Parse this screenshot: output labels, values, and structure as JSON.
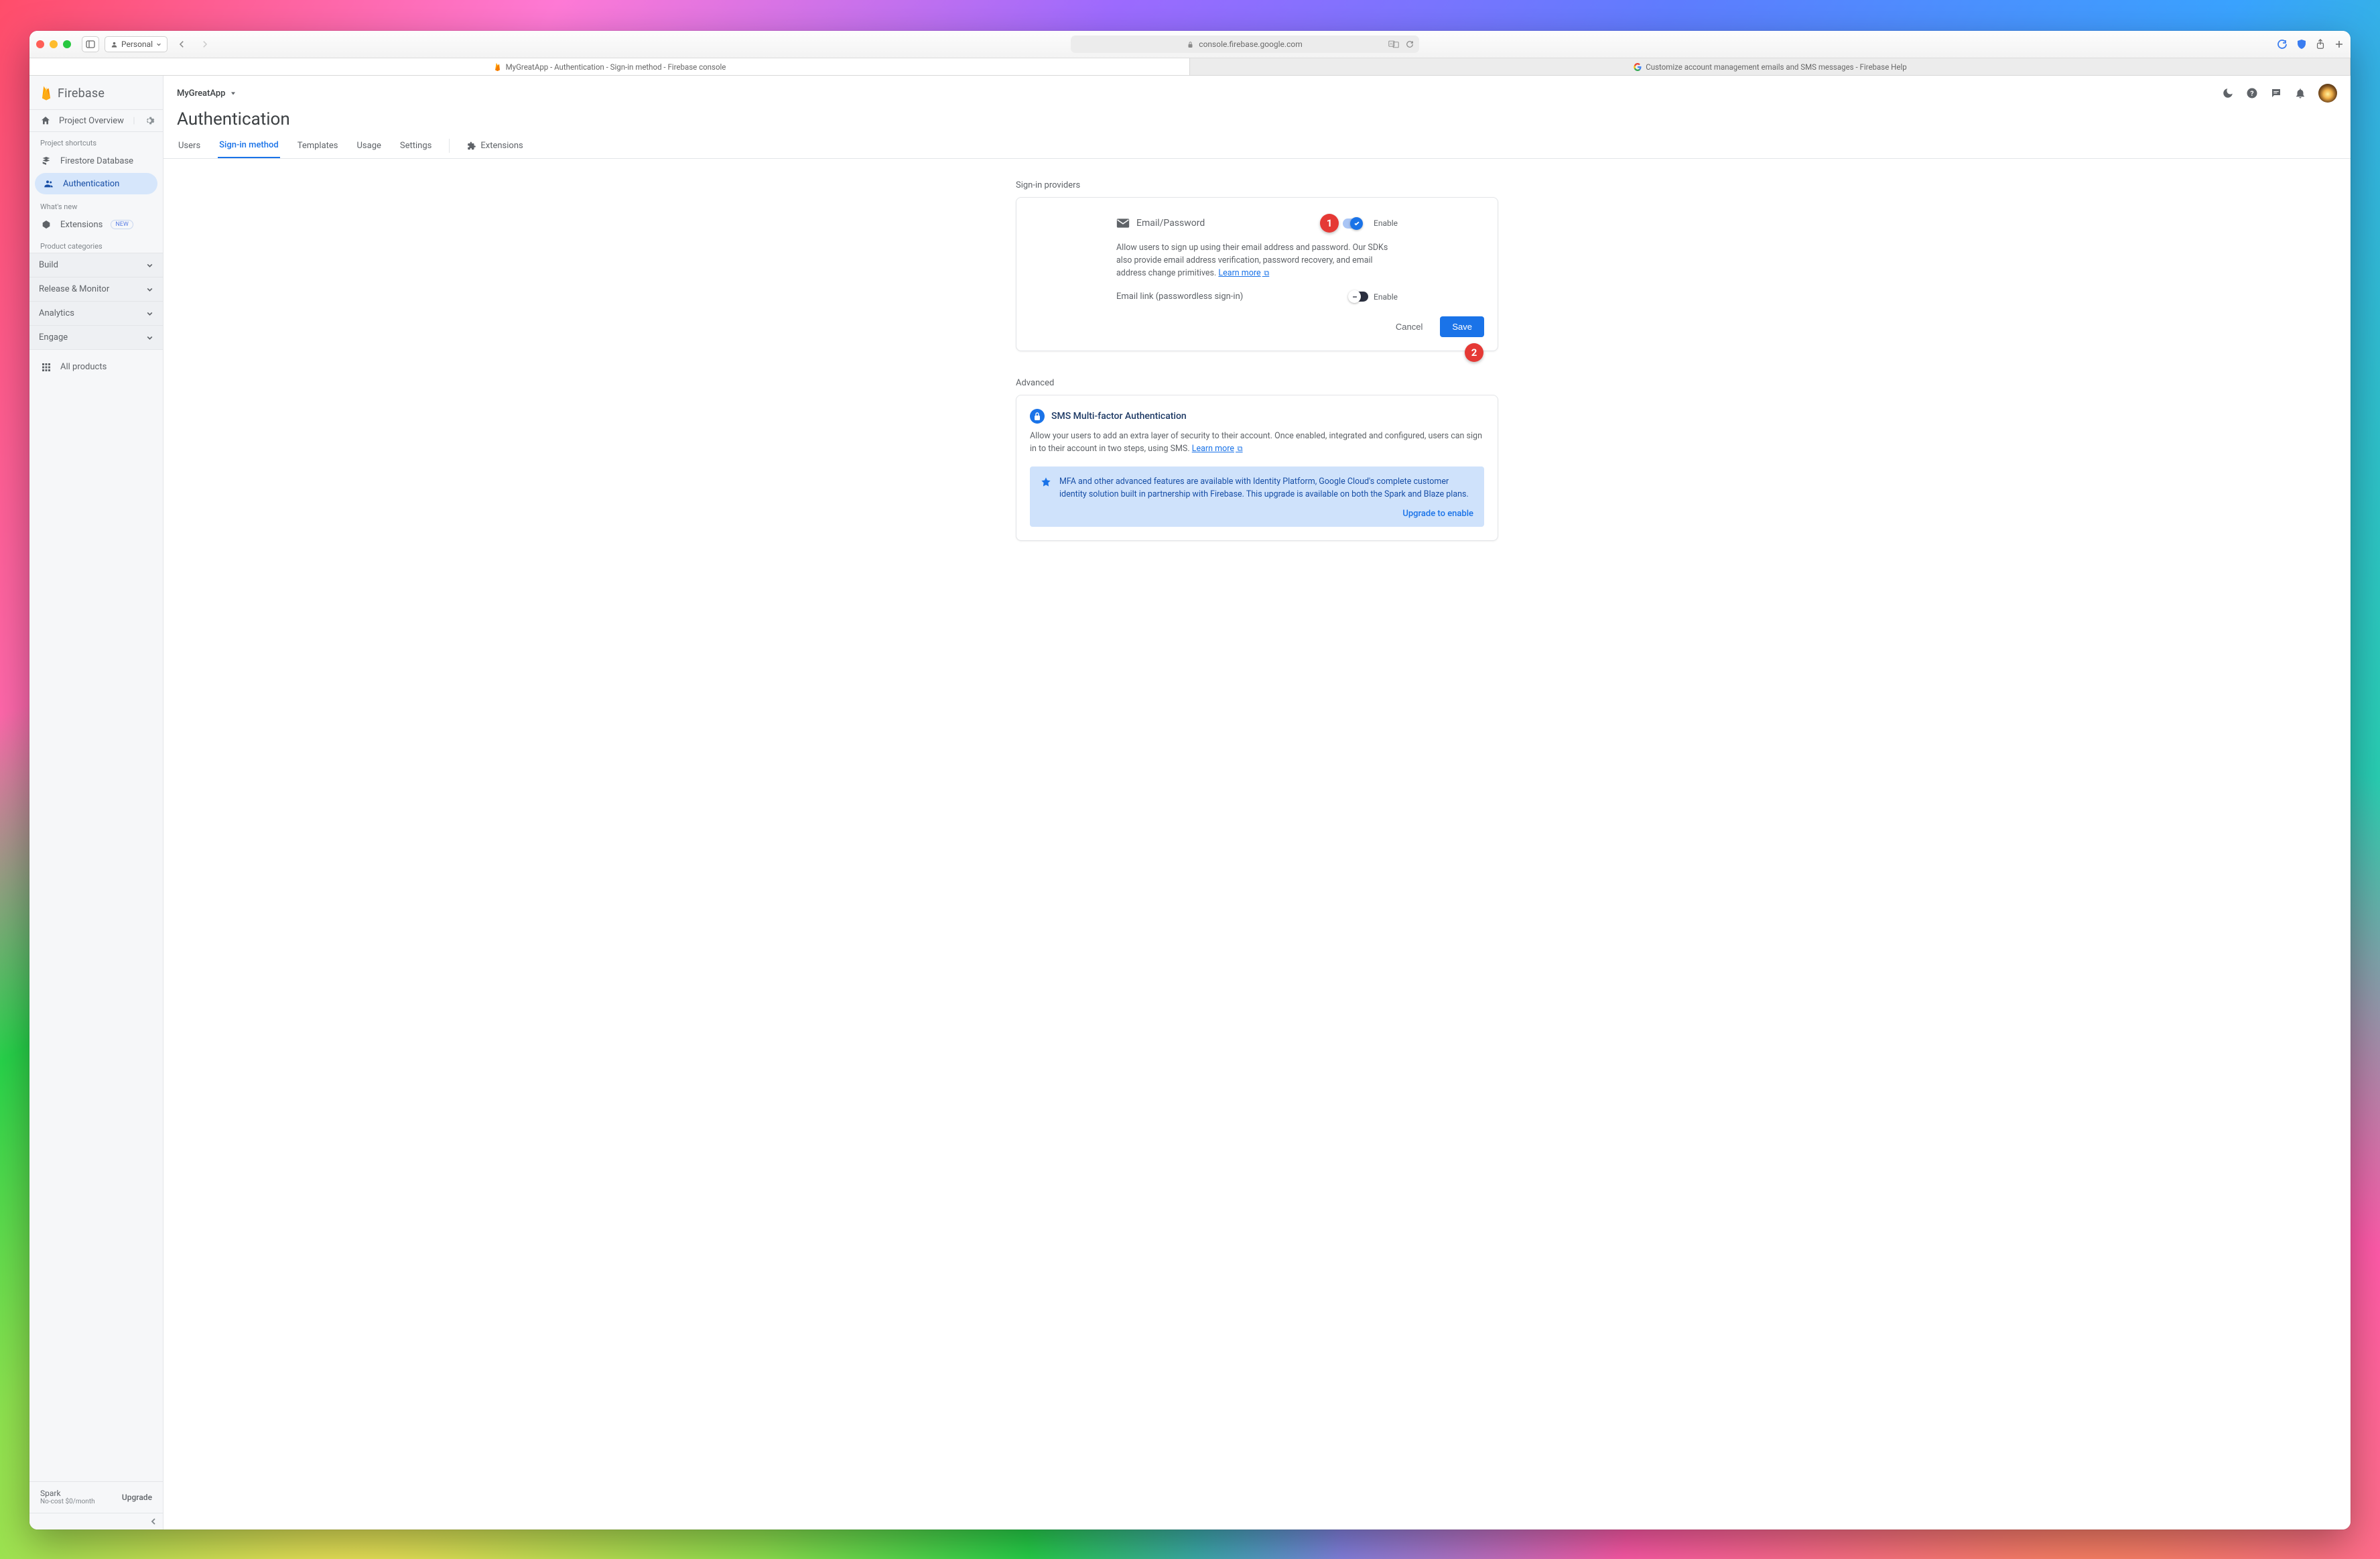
{
  "safari": {
    "profile_label": "Personal",
    "url_display": "console.firebase.google.com",
    "tabs": [
      {
        "title": "MyGreatApp - Authentication - Sign-in method - Firebase console",
        "active": true
      },
      {
        "title": "Customize account management emails and SMS messages - Firebase Help",
        "active": false
      }
    ]
  },
  "firebase": {
    "brand": "Firebase",
    "project_name": "MyGreatApp",
    "page_title": "Authentication",
    "sidebar": {
      "overview": "Project Overview",
      "shortcuts_label": "Project shortcuts",
      "shortcuts": [
        {
          "label": "Firestore Database",
          "active": false
        },
        {
          "label": "Authentication",
          "active": true
        }
      ],
      "whats_new_label": "What's new",
      "extensions_label": "Extensions",
      "new_badge": "NEW",
      "categories_label": "Product categories",
      "categories": [
        "Build",
        "Release & Monitor",
        "Analytics",
        "Engage"
      ],
      "all_products": "All products",
      "plan_name": "Spark",
      "plan_sub": "No-cost $0/month",
      "upgrade": "Upgrade"
    },
    "tabs": [
      "Users",
      "Sign-in method",
      "Templates",
      "Usage",
      "Settings"
    ],
    "active_tab": "Sign-in method",
    "extensions_tab": "Extensions",
    "providers_heading": "Sign-in providers",
    "provider": {
      "name": "Email/Password",
      "enable_label": "Enable",
      "description_pre": "Allow users to sign up using their email address and password. Our SDKs also provide email address verification, password recovery, and email address change primitives. ",
      "learn_more": "Learn more",
      "email_link_label": "Email link (passwordless sign-in)",
      "email_link_enable": "Enable",
      "cancel": "Cancel",
      "save": "Save"
    },
    "advanced_heading": "Advanced",
    "mfa": {
      "title": "SMS Multi-factor Authentication",
      "description_pre": "Allow your users to add an extra layer of security to their account. Once enabled, integrated and configured, users can sign in to their account in two steps, using SMS. ",
      "learn_more": "Learn more",
      "banner_text": "MFA and other advanced features are available with Identity Platform, Google Cloud's complete customer identity solution built in partnership with Firebase. This upgrade is available on both the Spark and Blaze plans.",
      "upgrade_link": "Upgrade to enable"
    },
    "callouts": {
      "one": "1",
      "two": "2"
    }
  }
}
